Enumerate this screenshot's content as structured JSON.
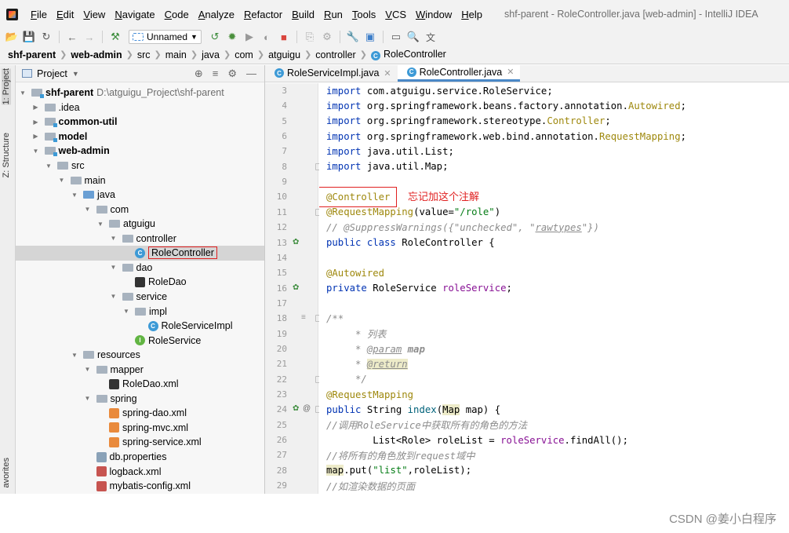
{
  "menubar": {
    "items": [
      "File",
      "Edit",
      "View",
      "Navigate",
      "Code",
      "Analyze",
      "Refactor",
      "Build",
      "Run",
      "Tools",
      "VCS",
      "Window",
      "Help"
    ],
    "window_title": "shf-parent - RoleController.java [web-admin] - IntelliJ IDEA"
  },
  "toolbar": {
    "run_config": "Unnamed"
  },
  "navbar": {
    "crumbs": [
      "shf-parent",
      "web-admin",
      "src",
      "main",
      "java",
      "com",
      "atguigu",
      "controller",
      "RoleController"
    ]
  },
  "tool_strip": {
    "project_tab": "1: Project",
    "structure_tab": "Z: Structure",
    "favorites_tab": "avorites"
  },
  "project_panel": {
    "title": "Project",
    "root_path": "D:\\atguigu_Project\\shf-parent",
    "tree": [
      {
        "label": "shf-parent",
        "depth": 0,
        "arrow": "▼",
        "icon": "module",
        "bold": true
      },
      {
        "label": ".idea",
        "depth": 1,
        "arrow": "▶",
        "icon": "folder"
      },
      {
        "label": "common-util",
        "depth": 1,
        "arrow": "▶",
        "icon": "module",
        "bold": true
      },
      {
        "label": "model",
        "depth": 1,
        "arrow": "▶",
        "icon": "module",
        "bold": true
      },
      {
        "label": "web-admin",
        "depth": 1,
        "arrow": "▼",
        "icon": "module",
        "bold": true
      },
      {
        "label": "src",
        "depth": 2,
        "arrow": "▼",
        "icon": "folder"
      },
      {
        "label": "main",
        "depth": 3,
        "arrow": "▼",
        "icon": "folder"
      },
      {
        "label": "java",
        "depth": 4,
        "arrow": "▼",
        "icon": "src"
      },
      {
        "label": "com",
        "depth": 5,
        "arrow": "▼",
        "icon": "folder"
      },
      {
        "label": "atguigu",
        "depth": 6,
        "arrow": "▼",
        "icon": "folder"
      },
      {
        "label": "controller",
        "depth": 7,
        "arrow": "▼",
        "icon": "folder"
      },
      {
        "label": "RoleController",
        "depth": 8,
        "arrow": "",
        "icon": "class",
        "selected": true
      },
      {
        "label": "dao",
        "depth": 7,
        "arrow": "▼",
        "icon": "folder"
      },
      {
        "label": "RoleDao",
        "depth": 8,
        "arrow": "",
        "icon": "mybatis"
      },
      {
        "label": "service",
        "depth": 7,
        "arrow": "▼",
        "icon": "folder"
      },
      {
        "label": "impl",
        "depth": 8,
        "arrow": "▼",
        "icon": "folder"
      },
      {
        "label": "RoleServiceImpl",
        "depth": 9,
        "arrow": "",
        "icon": "class"
      },
      {
        "label": "RoleService",
        "depth": 8,
        "arrow": "",
        "icon": "interface"
      },
      {
        "label": "resources",
        "depth": 4,
        "arrow": "▼",
        "icon": "res"
      },
      {
        "label": "mapper",
        "depth": 5,
        "arrow": "▼",
        "icon": "folder"
      },
      {
        "label": "RoleDao.xml",
        "depth": 6,
        "arrow": "",
        "icon": "mybatis"
      },
      {
        "label": "spring",
        "depth": 5,
        "arrow": "▼",
        "icon": "folder"
      },
      {
        "label": "spring-dao.xml",
        "depth": 6,
        "arrow": "",
        "icon": "xml"
      },
      {
        "label": "spring-mvc.xml",
        "depth": 6,
        "arrow": "",
        "icon": "xml"
      },
      {
        "label": "spring-service.xml",
        "depth": 6,
        "arrow": "",
        "icon": "xml"
      },
      {
        "label": "db.properties",
        "depth": 5,
        "arrow": "",
        "icon": "props"
      },
      {
        "label": "logback.xml",
        "depth": 5,
        "arrow": "",
        "icon": "xml-red"
      },
      {
        "label": "mybatis-config.xml",
        "depth": 5,
        "arrow": "",
        "icon": "xml-red"
      }
    ]
  },
  "editor": {
    "tabs": [
      {
        "label": "RoleServiceImpl.java",
        "active": false
      },
      {
        "label": "RoleController.java",
        "active": true
      }
    ],
    "annotation_note": "忘记加这个注解",
    "lines": [
      {
        "n": "3",
        "html": "<span class=\"kw\">import</span> com.atguigu.service.RoleService;"
      },
      {
        "n": "4",
        "html": "<span class=\"kw\">import</span> org.springframework.beans.factory.annotation.<span class=\"ann\">Autowired</span>;"
      },
      {
        "n": "5",
        "html": "<span class=\"kw\">import</span> org.springframework.stereotype.<span class=\"ann\">Controller</span>;"
      },
      {
        "n": "6",
        "html": "<span class=\"kw\">import</span> org.springframework.web.bind.annotation.<span class=\"ann\">RequestMapping</span>;"
      },
      {
        "n": "7",
        "html": "<span class=\"kw\">import</span> java.util.List;"
      },
      {
        "n": "8",
        "html": "<span class=\"kw\">import</span> java.util.Map;"
      },
      {
        "n": "9",
        "html": ""
      },
      {
        "n": "10",
        "html": "<span class=\"ann\">@Controller</span>"
      },
      {
        "n": "11",
        "html": "<span class=\"ann\">@RequestMapping</span>(value=<span class=\"str\">\"/role\"</span>)"
      },
      {
        "n": "12",
        "html": "<span class=\"cmt\">// @SuppressWarnings({\"unchecked\", \"<u>rawtypes</u>\"})</span>"
      },
      {
        "n": "13",
        "html": "<span class=\"kw\">public class</span> RoleController {"
      },
      {
        "n": "14",
        "html": ""
      },
      {
        "n": "15",
        "html": "    <span class=\"ann\">@Autowired</span>"
      },
      {
        "n": "16",
        "html": "    <span class=\"kw\">private</span> RoleService <span class=\"field\">roleService</span>;"
      },
      {
        "n": "17",
        "html": ""
      },
      {
        "n": "18",
        "html": "    <span class=\"cmt\">/**</span>"
      },
      {
        "n": "19",
        "html": "<span class=\"cmt\">     * 列表</span>"
      },
      {
        "n": "20",
        "html": "<span class=\"cmt\">     * <u>@param</u> <b>map</b></span>"
      },
      {
        "n": "21",
        "html": "<span class=\"cmt\">     * <span class=\"hl-bg\"><u>@return</u></span></span>"
      },
      {
        "n": "22",
        "html": "<span class=\"cmt\">     */</span>"
      },
      {
        "n": "23",
        "html": "    <span class=\"ann\">@RequestMapping</span>"
      },
      {
        "n": "24",
        "html": "    <span class=\"kw\">public</span> String <span style=\"color:#00627a\">index</span>(<span class=\"hl-bg\">Map</span> map) {"
      },
      {
        "n": "25",
        "html": "        <span class=\"cmt\">//调用RoleService中获取所有的角色的方法</span>"
      },
      {
        "n": "26",
        "html": "        List&lt;Role&gt; roleList = <span class=\"field\">roleService</span>.findAll();"
      },
      {
        "n": "27",
        "html": "        <span class=\"cmt\">//将所有的角色放到request域中</span>"
      },
      {
        "n": "28",
        "html": "         <span class=\"hl-bg\">map</span>.put(<span class=\"str\">\"list\"</span>,roleList);"
      },
      {
        "n": "29",
        "html": "         <span class=\"cmt\">//如渲染数据的页面</span>"
      }
    ]
  },
  "watermark": "CSDN @姜小白程序"
}
